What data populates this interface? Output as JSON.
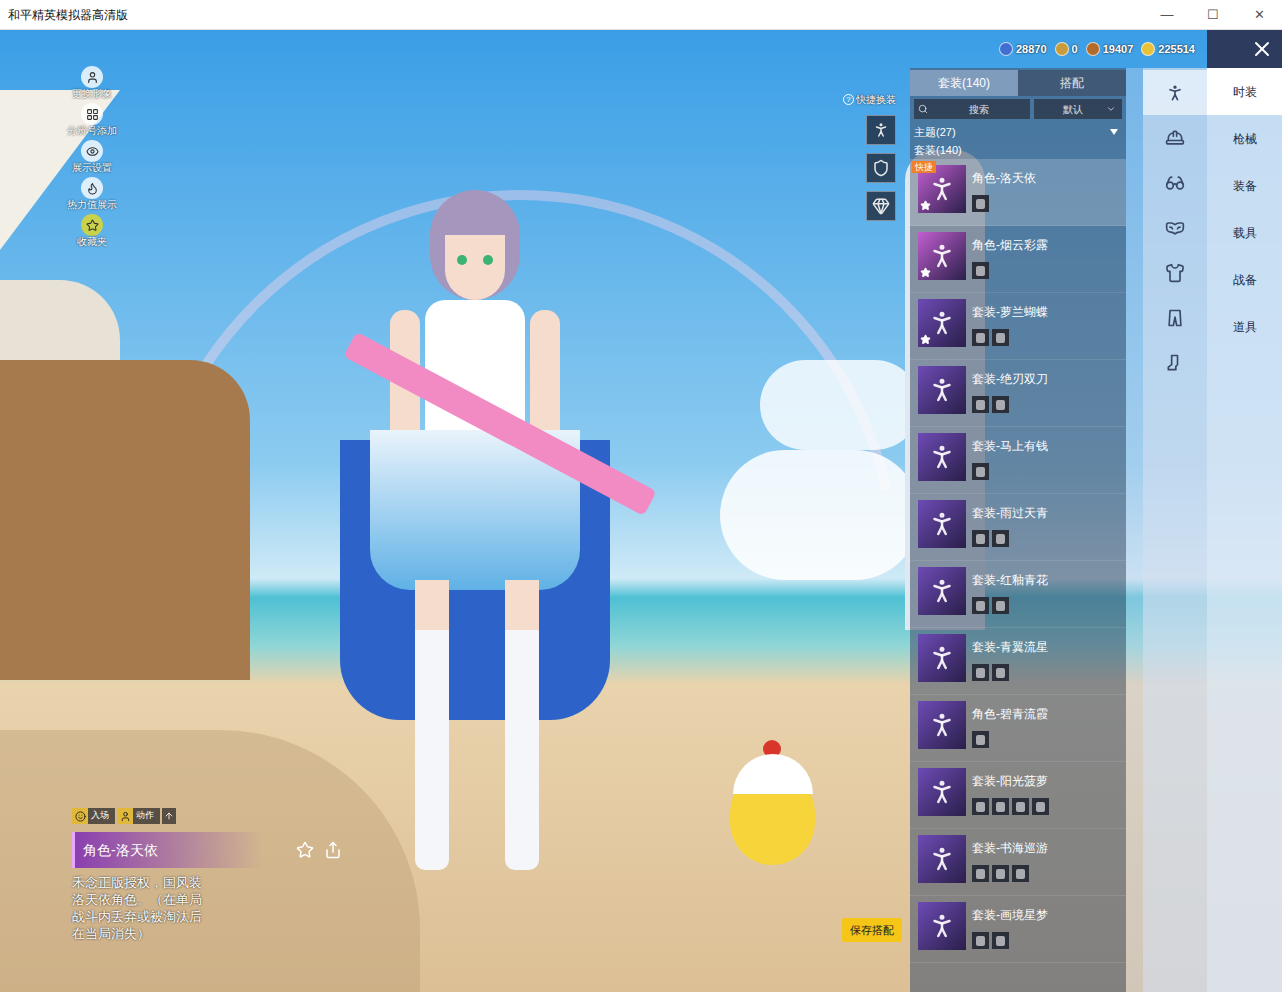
{
  "window": {
    "title": "和平精英模拟器高清版",
    "controls": [
      "—",
      "☐",
      "✕"
    ]
  },
  "left_menu": [
    {
      "label": "更换形象"
    },
    {
      "label": "分辨号添加"
    },
    {
      "label": "展示设置"
    },
    {
      "label": "热力值展示"
    },
    {
      "label": "收藏夹"
    }
  ],
  "currencies": [
    {
      "value": "28870",
      "color": "#3f6fd0"
    },
    {
      "value": "0",
      "color": "#c89b3c"
    },
    {
      "value": "19407",
      "color": "#b36b2a"
    },
    {
      "value": "225514",
      "color": "#e8c23a"
    }
  ],
  "quick_switch": {
    "help": "?",
    "label": "快捷换装",
    "slots": [
      {
        "kind": "figure"
      },
      {
        "kind": "emblem"
      },
      {
        "kind": "gem"
      }
    ]
  },
  "list_panel": {
    "tabs": [
      {
        "label": "套装(140)",
        "selected": true
      },
      {
        "label": "搭配",
        "selected": false
      }
    ],
    "search": {
      "placeholder": "搜索"
    },
    "sort": {
      "value": "默认"
    },
    "groups": [
      {
        "label": "主题(27)",
        "has_menu": true
      },
      {
        "label": "套装(140)",
        "has_menu": false
      }
    ],
    "items": [
      {
        "name": "角色-洛天依",
        "selected": true,
        "favorite": true,
        "badge": "快捷",
        "parts": 1,
        "color": "#c25fd0"
      },
      {
        "name": "角色-烟云彩露",
        "selected": false,
        "favorite": true,
        "badge": "",
        "parts": 1,
        "color": "#c25fd0"
      },
      {
        "name": "套装-萝兰蝴蝶",
        "selected": false,
        "favorite": true,
        "badge": "",
        "parts": 2,
        "color": "#6d4bb5"
      },
      {
        "name": "套装-绝刃双刀",
        "selected": false,
        "favorite": false,
        "badge": "",
        "parts": 2,
        "color": "#6d4bb5"
      },
      {
        "name": "套装-马上有钱",
        "selected": false,
        "favorite": false,
        "badge": "",
        "parts": 1,
        "color": "#6d4bb5"
      },
      {
        "name": "套装-雨过天青",
        "selected": false,
        "favorite": false,
        "badge": "",
        "parts": 2,
        "color": "#6d4bb5"
      },
      {
        "name": "套装-红釉青花",
        "selected": false,
        "favorite": false,
        "badge": "",
        "parts": 2,
        "color": "#6d4bb5"
      },
      {
        "name": "套装-青翼流星",
        "selected": false,
        "favorite": false,
        "badge": "",
        "parts": 2,
        "color": "#6d4bb5"
      },
      {
        "name": "角色-碧青流霞",
        "selected": false,
        "favorite": false,
        "badge": "",
        "parts": 1,
        "color": "#6d4bb5"
      },
      {
        "name": "套装-阳光菠萝",
        "selected": false,
        "favorite": false,
        "badge": "",
        "parts": 4,
        "color": "#6d4bb5"
      },
      {
        "name": "套装-书海巡游",
        "selected": false,
        "favorite": false,
        "badge": "",
        "parts": 3,
        "color": "#6d4bb5"
      },
      {
        "name": "套装-画境星梦",
        "selected": false,
        "favorite": false,
        "badge": "",
        "parts": 2,
        "color": "#6d4bb5"
      }
    ]
  },
  "categories": [
    {
      "selected": true
    },
    {
      "selected": false
    },
    {
      "selected": false
    },
    {
      "selected": false
    },
    {
      "selected": false
    },
    {
      "selected": false
    },
    {
      "selected": false
    }
  ],
  "nav": [
    {
      "label": "时装",
      "selected": true
    },
    {
      "label": "枪械",
      "selected": false
    },
    {
      "label": "装备",
      "selected": false
    },
    {
      "label": "载具",
      "selected": false
    },
    {
      "label": "战备",
      "selected": false
    },
    {
      "label": "道具",
      "selected": false
    }
  ],
  "selected_info": {
    "tabs": [
      {
        "label": "入场",
        "selected": false
      },
      {
        "label": "动作",
        "selected": false
      }
    ],
    "name": "角色-洛天依",
    "description": "禾念正版授权，国风装洛天依角色。（在单局战斗内丢弃或被淘汰后在当局消失）"
  },
  "save_button": "保存搭配"
}
